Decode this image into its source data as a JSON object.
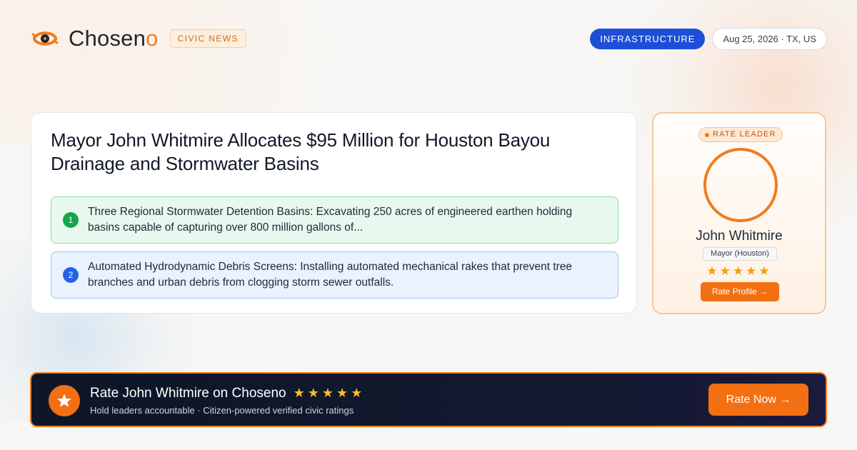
{
  "brand": {
    "name_main": "Chosen",
    "name_accent": "o",
    "tag": "CIVIC NEWS",
    "accent_color": "#f07c1e"
  },
  "header": {
    "category": "INFRASTRUCTURE",
    "date_location": "Aug 25, 2026 · TX, US"
  },
  "article": {
    "headline": "Mayor John Whitmire Allocates $95 Million for Houston Bayou Drainage and Stormwater Basins",
    "points": [
      {
        "number": "1",
        "text": "Three Regional Stormwater Detention Basins: Excavating 250 acres of engineered earthen holding basins capable of capturing over 800 million gallons of..."
      },
      {
        "number": "2",
        "text": "Automated Hydrodynamic Debris Screens: Installing automated mechanical rakes that prevent tree branches and urban debris from clogging storm sewer outfalls."
      }
    ]
  },
  "leader_card": {
    "badge": "RATE LEADER",
    "name": "John Whitmire",
    "role": "Mayor (Houston)",
    "stars": "★★★★★",
    "button": "Rate Profile →"
  },
  "banner": {
    "title": "Rate John Whitmire on Choseno",
    "stars": "★★★★★",
    "subtitle": "Hold leaders accountable · Citizen-powered verified civic ratings",
    "cta": "Rate Now →"
  },
  "icons": {
    "logo": "eye-logo-icon",
    "banner": "star-icon"
  }
}
